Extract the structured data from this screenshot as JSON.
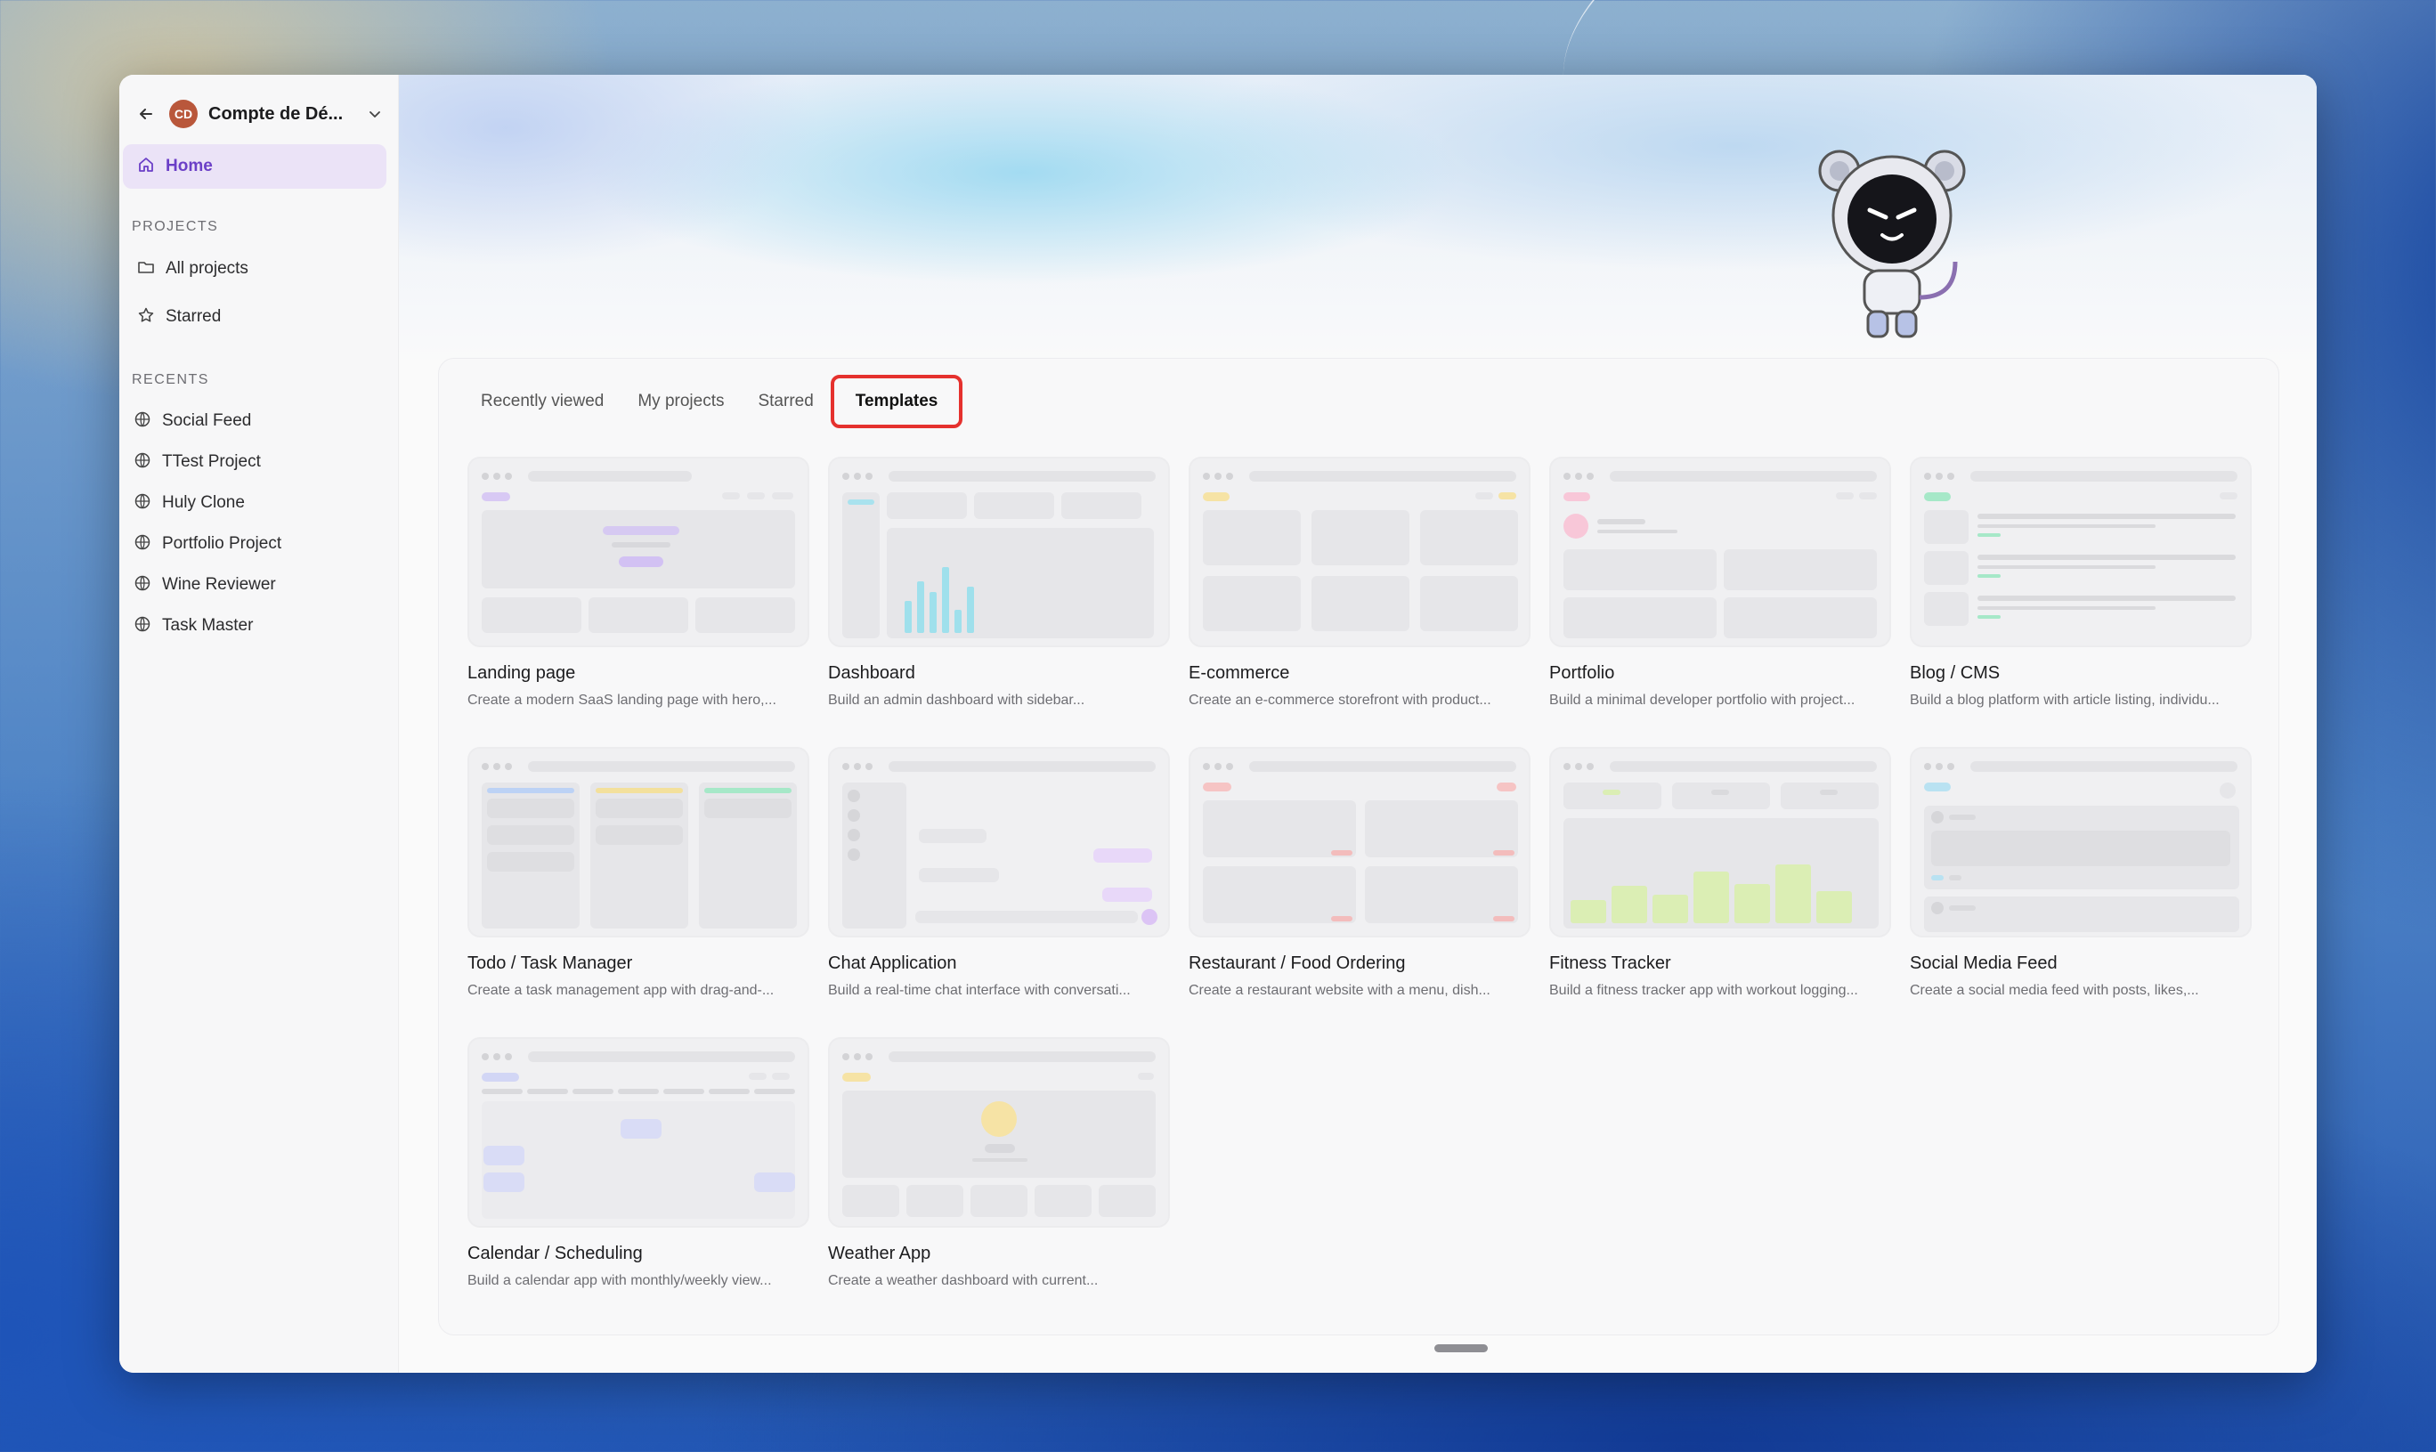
{
  "account": {
    "initials": "CD",
    "name": "Compte de Dé..."
  },
  "sidebar": {
    "home_label": "Home",
    "projects_title": "PROJECTS",
    "projects": [
      {
        "label": "All projects",
        "icon": "folder-icon"
      },
      {
        "label": "Starred",
        "icon": "star-icon"
      }
    ],
    "recents_title": "RECENTS",
    "recents": [
      {
        "label": "Social Feed",
        "icon": "globe-icon"
      },
      {
        "label": "TTest Project",
        "icon": "globe-icon"
      },
      {
        "label": "Huly Clone",
        "icon": "globe-icon"
      },
      {
        "label": "Portfolio Project",
        "icon": "globe-icon"
      },
      {
        "label": "Wine Reviewer",
        "icon": "globe-icon"
      },
      {
        "label": "Task Master",
        "icon": "globe-icon"
      }
    ]
  },
  "tabs": [
    {
      "label": "Recently viewed",
      "active": false
    },
    {
      "label": "My projects",
      "active": false
    },
    {
      "label": "Starred",
      "active": false
    },
    {
      "label": "Templates",
      "active": true
    }
  ],
  "templates": [
    {
      "title": "Landing page",
      "desc": "Create a modern SaaS landing page with hero,..."
    },
    {
      "title": "Dashboard",
      "desc": "Build an admin dashboard with sidebar..."
    },
    {
      "title": "E-commerce",
      "desc": "Create an e-commerce storefront with product..."
    },
    {
      "title": "Portfolio",
      "desc": "Build a minimal developer portfolio with project..."
    },
    {
      "title": "Blog / CMS",
      "desc": "Build a blog platform with article listing, individu..."
    },
    {
      "title": "Todo / Task Manager",
      "desc": "Create a task management app with drag-and-..."
    },
    {
      "title": "Chat Application",
      "desc": "Build a real-time chat interface with conversati..."
    },
    {
      "title": "Restaurant / Food Ordering",
      "desc": "Create a restaurant website with a menu, dish..."
    },
    {
      "title": "Fitness Tracker",
      "desc": "Build a fitness tracker app with workout logging..."
    },
    {
      "title": "Social Media Feed",
      "desc": "Create a social media feed with posts, likes,..."
    },
    {
      "title": "Calendar / Scheduling",
      "desc": "Build a calendar app with monthly/weekly view..."
    },
    {
      "title": "Weather App",
      "desc": "Create a weather dashboard with current..."
    }
  ],
  "colors": {
    "accent": "#6b3fc7",
    "highlight": "#e5312e",
    "fab": "#1f6b4e"
  }
}
